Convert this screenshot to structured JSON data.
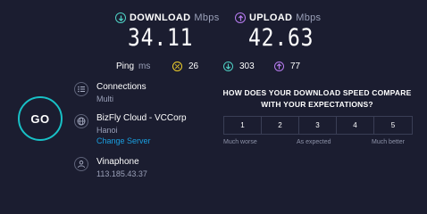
{
  "download": {
    "label": "DOWNLOAD",
    "unit": "Mbps",
    "value": "34.11",
    "icon": "download-arrow-icon",
    "color": "#4fd1c5"
  },
  "upload": {
    "label": "UPLOAD",
    "unit": "Mbps",
    "value": "42.63",
    "icon": "upload-arrow-icon",
    "color": "#b77cf0"
  },
  "ping": {
    "label": "Ping",
    "unit": "ms",
    "idle": "26",
    "download": "303",
    "upload": "77",
    "idle_color": "#f2d12b"
  },
  "go_button": {
    "label": "GO",
    "ring_color": "#18c0c6"
  },
  "connections": {
    "title": "Connections",
    "value": "Multi",
    "icon": "connections-icon"
  },
  "server": {
    "title": "BizFly Cloud - VCCorp",
    "location": "Hanoi",
    "change_label": "Change Server",
    "icon": "globe-icon"
  },
  "provider": {
    "title": "Vinaphone",
    "ip": "113.185.43.37",
    "icon": "user-icon"
  },
  "survey": {
    "question_line1": "HOW DOES YOUR DOWNLOAD SPEED COMPARE",
    "question_line2": "WITH YOUR EXPECTATIONS?",
    "options": [
      "1",
      "2",
      "3",
      "4",
      "5"
    ],
    "low_label": "Much worse",
    "mid_label": "As expected",
    "high_label": "Much better"
  }
}
